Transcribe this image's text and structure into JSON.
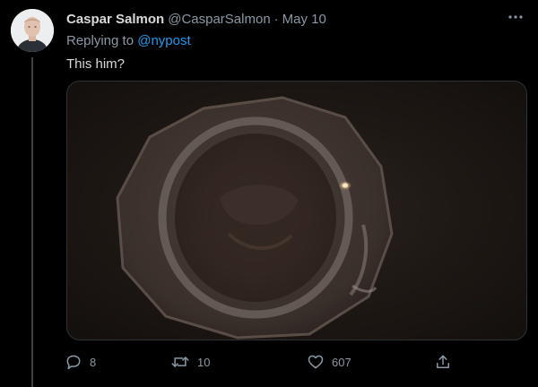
{
  "author": {
    "display_name": "Caspar Salmon",
    "handle": "@CasparSalmon",
    "separator": "·",
    "timestamp": "May 10"
  },
  "reply_context": {
    "prefix": "Replying to",
    "mention": "@nypost"
  },
  "tweet": {
    "text": "This him?"
  },
  "metrics": {
    "replies": "8",
    "retweets": "10",
    "likes": "607"
  },
  "icons": {
    "more": "more-horizontal-icon",
    "reply": "reply-icon",
    "retweet": "retweet-icon",
    "like": "heart-icon",
    "share": "share-icon"
  },
  "colors": {
    "background": "#000000",
    "primary_text": "#d9d9d9",
    "secondary_text": "#8b98a5",
    "link": "#1d9bf0",
    "thread_line": "#3d4144"
  }
}
